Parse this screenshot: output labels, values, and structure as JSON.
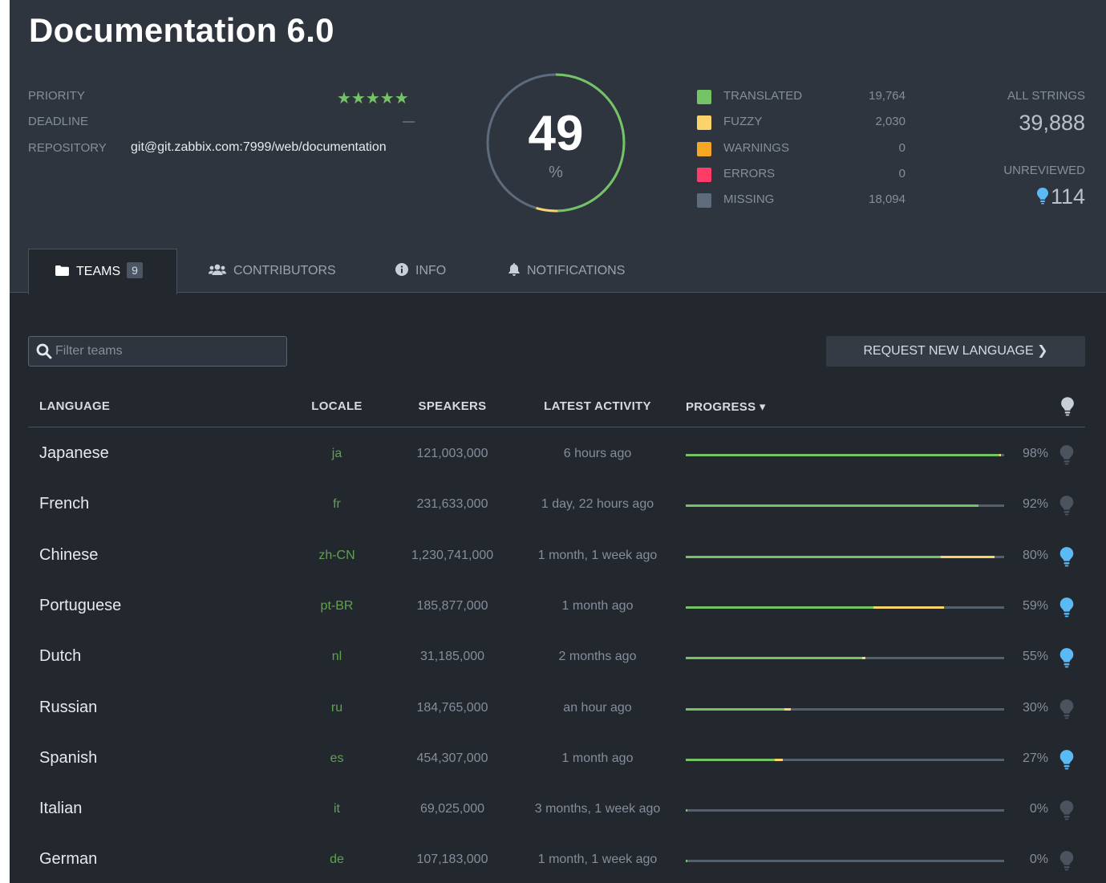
{
  "project": {
    "title": "Documentation 6.0",
    "priority_label": "PRIORITY",
    "priority_stars": "★★★★★",
    "deadline_label": "DEADLINE",
    "deadline_value": "—",
    "repository_label": "REPOSITORY",
    "repository_value": "git@git.zabbix.com:7999/web/documentation"
  },
  "progress": {
    "percent": "49",
    "percent_unit": "%",
    "translated_fraction": 0.4955,
    "fuzzy_fraction": 0.0509
  },
  "legend": [
    {
      "label": "TRANSLATED",
      "value": "19,764",
      "color": "#74c366"
    },
    {
      "label": "FUZZY",
      "value": "2,030",
      "color": "#fcd36b"
    },
    {
      "label": "WARNINGS",
      "value": "0",
      "color": "#f5a623"
    },
    {
      "label": "ERRORS",
      "value": "0",
      "color": "#ff3b68"
    },
    {
      "label": "MISSING",
      "value": "18,094",
      "color": "#5e6b7c"
    }
  ],
  "summary": {
    "all_strings_label": "ALL STRINGS",
    "all_strings_value": "39,888",
    "unreviewed_label": "UNREVIEWED",
    "unreviewed_value": "114"
  },
  "tabs": [
    {
      "label": "TEAMS",
      "badge": "9",
      "icon": "folder-icon"
    },
    {
      "label": "CONTRIBUTORS",
      "icon": "users-icon"
    },
    {
      "label": "INFO",
      "icon": "info-icon"
    },
    {
      "label": "NOTIFICATIONS",
      "icon": "bell-icon"
    }
  ],
  "filter": {
    "placeholder": "Filter teams"
  },
  "request_button": {
    "label": "REQUEST NEW LANGUAGE ❯"
  },
  "table": {
    "headers": {
      "language": "LANGUAGE",
      "locale": "LOCALE",
      "speakers": "SPEAKERS",
      "latest_activity": "LATEST ACTIVITY",
      "progress": "PROGRESS ▾"
    },
    "rows": [
      {
        "language": "Japanese",
        "locale": "ja",
        "speakers": "121,003,000",
        "activity": "6 hours ago",
        "progress": "98%",
        "translated": 0.985,
        "fuzzy": 0.005,
        "reviewed": false
      },
      {
        "language": "French",
        "locale": "fr",
        "speakers": "231,633,000",
        "activity": "1 day, 22 hours ago",
        "progress": "92%",
        "translated": 0.92,
        "fuzzy": 0.0,
        "reviewed": false
      },
      {
        "language": "Chinese",
        "locale": "zh-CN",
        "speakers": "1,230,741,000",
        "activity": "1 month, 1 week ago",
        "progress": "80%",
        "translated": 0.8,
        "fuzzy": 0.17,
        "reviewed": true
      },
      {
        "language": "Portuguese",
        "locale": "pt-BR",
        "speakers": "185,877,000",
        "activity": "1 month ago",
        "progress": "59%",
        "translated": 0.59,
        "fuzzy": 0.22,
        "reviewed": true
      },
      {
        "language": "Dutch",
        "locale": "nl",
        "speakers": "31,185,000",
        "activity": "2 months ago",
        "progress": "55%",
        "translated": 0.555,
        "fuzzy": 0.008,
        "reviewed": true
      },
      {
        "language": "Russian",
        "locale": "ru",
        "speakers": "184,765,000",
        "activity": "an hour ago",
        "progress": "30%",
        "translated": 0.31,
        "fuzzy": 0.02,
        "reviewed": false
      },
      {
        "language": "Spanish",
        "locale": "es",
        "speakers": "454,307,000",
        "activity": "1 month ago",
        "progress": "27%",
        "translated": 0.28,
        "fuzzy": 0.025,
        "reviewed": true
      },
      {
        "language": "Italian",
        "locale": "it",
        "speakers": "69,025,000",
        "activity": "3 months, 1 week ago",
        "progress": "0%",
        "translated": 0.005,
        "fuzzy": 0.0,
        "reviewed": false
      },
      {
        "language": "German",
        "locale": "de",
        "speakers": "107,183,000",
        "activity": "1 month, 1 week ago",
        "progress": "0%",
        "translated": 0.005,
        "fuzzy": 0.0,
        "reviewed": false
      }
    ]
  },
  "colors": {
    "translated": "#74c366",
    "fuzzy": "#fcd36b",
    "missing": "#54606d",
    "bulb_active": "#5bb9f5",
    "bulb_inactive": "#4b535e"
  }
}
